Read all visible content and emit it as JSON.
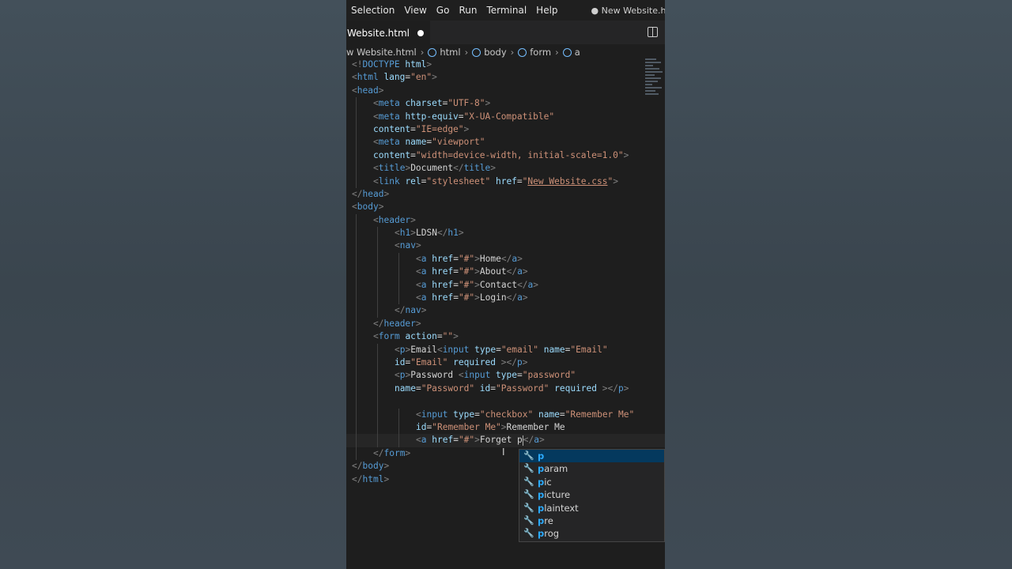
{
  "menu": [
    "Selection",
    "View",
    "Go",
    "Run",
    "Terminal",
    "Help"
  ],
  "window_title": "● New Website.html - Co",
  "tab": {
    "label": "Website.html"
  },
  "breadcrumb": [
    "w Website.html",
    "html",
    "body",
    "form",
    "a"
  ],
  "suggestions": [
    {
      "prefix": "p",
      "rest": ""
    },
    {
      "prefix": "p",
      "rest": "aram"
    },
    {
      "prefix": "p",
      "rest": "ic"
    },
    {
      "prefix": "p",
      "rest": "icture"
    },
    {
      "prefix": "p",
      "rest": "laintext"
    },
    {
      "prefix": "p",
      "rest": "re"
    },
    {
      "prefix": "p",
      "rest": "rog"
    }
  ],
  "colors": {
    "tag": "#569cd6",
    "attr": "#9cdcfe",
    "string": "#ce9178",
    "text": "#d4d4d4",
    "bracket": "#808080"
  },
  "code": [
    {
      "indent": 0,
      "tokens": [
        [
          "t",
          "<!"
        ],
        [
          "tn",
          "DOCTYPE"
        ],
        [
          "at",
          " html"
        ],
        [
          "t",
          ">"
        ]
      ]
    },
    {
      "indent": 0,
      "tokens": [
        [
          "t",
          "<"
        ],
        [
          "tn",
          "html"
        ],
        [
          "at",
          " lang"
        ],
        [
          "tx",
          "="
        ],
        [
          "st",
          "\"en\""
        ],
        [
          "t",
          ">"
        ]
      ]
    },
    {
      "indent": 0,
      "tokens": [
        [
          "t",
          "<"
        ],
        [
          "tn",
          "head"
        ],
        [
          "t",
          ">"
        ]
      ]
    },
    {
      "indent": 1,
      "tokens": [
        [
          "t",
          "<"
        ],
        [
          "tn",
          "meta"
        ],
        [
          "at",
          " charset"
        ],
        [
          "tx",
          "="
        ],
        [
          "st",
          "\"UTF-8\""
        ],
        [
          "t",
          ">"
        ]
      ]
    },
    {
      "indent": 1,
      "tokens": [
        [
          "t",
          "<"
        ],
        [
          "tn",
          "meta"
        ],
        [
          "at",
          " http-equiv"
        ],
        [
          "tx",
          "="
        ],
        [
          "st",
          "\"X-UA-Compatible\""
        ]
      ]
    },
    {
      "indent": 1,
      "tokens": [
        [
          "at",
          "content"
        ],
        [
          "tx",
          "="
        ],
        [
          "st",
          "\"IE=edge\""
        ],
        [
          "t",
          ">"
        ]
      ]
    },
    {
      "indent": 1,
      "tokens": [
        [
          "t",
          "<"
        ],
        [
          "tn",
          "meta"
        ],
        [
          "at",
          " name"
        ],
        [
          "tx",
          "="
        ],
        [
          "st",
          "\"viewport\""
        ]
      ]
    },
    {
      "indent": 1,
      "tokens": [
        [
          "at",
          "content"
        ],
        [
          "tx",
          "="
        ],
        [
          "st",
          "\"width=device-width, initial-scale=1.0\""
        ],
        [
          "t",
          ">"
        ]
      ]
    },
    {
      "indent": 1,
      "tokens": [
        [
          "t",
          "<"
        ],
        [
          "tn",
          "title"
        ],
        [
          "t",
          ">"
        ],
        [
          "tx",
          "Document"
        ],
        [
          "t",
          "</"
        ],
        [
          "tn",
          "title"
        ],
        [
          "t",
          ">"
        ]
      ]
    },
    {
      "indent": 1,
      "tokens": [
        [
          "t",
          "<"
        ],
        [
          "tn",
          "link"
        ],
        [
          "at",
          " rel"
        ],
        [
          "tx",
          "="
        ],
        [
          "st",
          "\"stylesheet\""
        ],
        [
          "at",
          " href"
        ],
        [
          "tx",
          "="
        ],
        [
          "st",
          "\""
        ],
        [
          "stu",
          "New Website.css"
        ],
        [
          "st",
          "\""
        ],
        [
          "t",
          ">"
        ]
      ]
    },
    {
      "indent": 0,
      "tokens": [
        [
          "t",
          "</"
        ],
        [
          "tn",
          "head"
        ],
        [
          "t",
          ">"
        ]
      ]
    },
    {
      "indent": 0,
      "tokens": [
        [
          "t",
          "<"
        ],
        [
          "tn",
          "body"
        ],
        [
          "t",
          ">"
        ]
      ]
    },
    {
      "indent": 1,
      "tokens": [
        [
          "t",
          "<"
        ],
        [
          "tn",
          "header"
        ],
        [
          "t",
          ">"
        ]
      ]
    },
    {
      "indent": 2,
      "tokens": [
        [
          "t",
          "<"
        ],
        [
          "tn",
          "h1"
        ],
        [
          "t",
          ">"
        ],
        [
          "tx",
          "LDSN"
        ],
        [
          "t",
          "</"
        ],
        [
          "tn",
          "h1"
        ],
        [
          "t",
          ">"
        ]
      ]
    },
    {
      "indent": 2,
      "tokens": [
        [
          "t",
          "<"
        ],
        [
          "tn",
          "nav"
        ],
        [
          "t",
          ">"
        ]
      ]
    },
    {
      "indent": 3,
      "tokens": [
        [
          "t",
          "<"
        ],
        [
          "tn",
          "a"
        ],
        [
          "at",
          " href"
        ],
        [
          "tx",
          "="
        ],
        [
          "st",
          "\"#\""
        ],
        [
          "t",
          ">"
        ],
        [
          "tx",
          "Home"
        ],
        [
          "t",
          "</"
        ],
        [
          "tn",
          "a"
        ],
        [
          "t",
          ">"
        ]
      ]
    },
    {
      "indent": 3,
      "tokens": [
        [
          "t",
          "<"
        ],
        [
          "tn",
          "a"
        ],
        [
          "at",
          " href"
        ],
        [
          "tx",
          "="
        ],
        [
          "st",
          "\"#\""
        ],
        [
          "t",
          ">"
        ],
        [
          "tx",
          "About"
        ],
        [
          "t",
          "</"
        ],
        [
          "tn",
          "a"
        ],
        [
          "t",
          ">"
        ]
      ]
    },
    {
      "indent": 3,
      "tokens": [
        [
          "t",
          "<"
        ],
        [
          "tn",
          "a"
        ],
        [
          "at",
          " href"
        ],
        [
          "tx",
          "="
        ],
        [
          "st",
          "\"#\""
        ],
        [
          "t",
          ">"
        ],
        [
          "tx",
          "Contact"
        ],
        [
          "t",
          "</"
        ],
        [
          "tn",
          "a"
        ],
        [
          "t",
          ">"
        ]
      ]
    },
    {
      "indent": 3,
      "tokens": [
        [
          "t",
          "<"
        ],
        [
          "tn",
          "a"
        ],
        [
          "at",
          " href"
        ],
        [
          "tx",
          "="
        ],
        [
          "st",
          "\"#\""
        ],
        [
          "t",
          ">"
        ],
        [
          "tx",
          "Login"
        ],
        [
          "t",
          "</"
        ],
        [
          "tn",
          "a"
        ],
        [
          "t",
          ">"
        ]
      ]
    },
    {
      "indent": 2,
      "tokens": [
        [
          "t",
          "</"
        ],
        [
          "tn",
          "nav"
        ],
        [
          "t",
          ">"
        ]
      ]
    },
    {
      "indent": 1,
      "tokens": [
        [
          "t",
          "</"
        ],
        [
          "tn",
          "header"
        ],
        [
          "t",
          ">"
        ]
      ]
    },
    {
      "indent": 1,
      "tokens": [
        [
          "t",
          "<"
        ],
        [
          "tn",
          "form"
        ],
        [
          "at",
          " action"
        ],
        [
          "tx",
          "="
        ],
        [
          "st",
          "\"\""
        ],
        [
          "t",
          ">"
        ]
      ]
    },
    {
      "indent": 2,
      "tokens": [
        [
          "t",
          "<"
        ],
        [
          "tn",
          "p"
        ],
        [
          "t",
          ">"
        ],
        [
          "tx",
          "Email"
        ],
        [
          "t",
          "<"
        ],
        [
          "tn",
          "input"
        ],
        [
          "at",
          " type"
        ],
        [
          "tx",
          "="
        ],
        [
          "st",
          "\"email\""
        ],
        [
          "at",
          " name"
        ],
        [
          "tx",
          "="
        ],
        [
          "st",
          "\"Email\""
        ]
      ]
    },
    {
      "indent": 2,
      "tokens": [
        [
          "at",
          "id"
        ],
        [
          "tx",
          "="
        ],
        [
          "st",
          "\"Email\""
        ],
        [
          "at",
          " required"
        ],
        [
          "t",
          " ></"
        ],
        [
          "tn",
          "p"
        ],
        [
          "t",
          ">"
        ]
      ]
    },
    {
      "indent": 2,
      "tokens": [
        [
          "t",
          "<"
        ],
        [
          "tn",
          "p"
        ],
        [
          "t",
          ">"
        ],
        [
          "tx",
          "Password "
        ],
        [
          "t",
          "<"
        ],
        [
          "tn",
          "input"
        ],
        [
          "at",
          " type"
        ],
        [
          "tx",
          "="
        ],
        [
          "st",
          "\"password\""
        ]
      ]
    },
    {
      "indent": 2,
      "tokens": [
        [
          "at",
          "name"
        ],
        [
          "tx",
          "="
        ],
        [
          "st",
          "\"Password\""
        ],
        [
          "at",
          " id"
        ],
        [
          "tx",
          "="
        ],
        [
          "st",
          "\"Password\""
        ],
        [
          "at",
          " required"
        ],
        [
          "t",
          " ></"
        ],
        [
          "tn",
          "p"
        ],
        [
          "t",
          ">"
        ]
      ]
    },
    {
      "indent": 2,
      "tokens": []
    },
    {
      "indent": 3,
      "tokens": [
        [
          "t",
          "<"
        ],
        [
          "tn",
          "input"
        ],
        [
          "at",
          " type"
        ],
        [
          "tx",
          "="
        ],
        [
          "st",
          "\"checkbox\""
        ],
        [
          "at",
          " name"
        ],
        [
          "tx",
          "="
        ],
        [
          "st",
          "\"Remember Me\""
        ]
      ]
    },
    {
      "indent": 3,
      "tokens": [
        [
          "at",
          "id"
        ],
        [
          "tx",
          "="
        ],
        [
          "st",
          "\"Remember Me\""
        ],
        [
          "t",
          ">"
        ],
        [
          "tx",
          "Remember Me"
        ]
      ]
    },
    {
      "indent": 3,
      "cur": true,
      "tokens": [
        [
          "t",
          "<"
        ],
        [
          "tn",
          "a"
        ],
        [
          "at",
          " href"
        ],
        [
          "tx",
          "="
        ],
        [
          "st",
          "\"#\""
        ],
        [
          "t",
          ">"
        ],
        [
          "tx",
          "Forget p"
        ],
        [
          "caret",
          ""
        ],
        [
          "t",
          "</"
        ],
        [
          "tn",
          "a"
        ],
        [
          "t",
          ">"
        ]
      ]
    },
    {
      "indent": 1,
      "tokens": [
        [
          "t",
          "</"
        ],
        [
          "tn",
          "form"
        ],
        [
          "t",
          ">"
        ]
      ]
    },
    {
      "indent": 0,
      "tokens": [
        [
          "t",
          "</"
        ],
        [
          "tn",
          "body"
        ],
        [
          "t",
          ">"
        ]
      ]
    },
    {
      "indent": 0,
      "tokens": [
        [
          "t",
          "</"
        ],
        [
          "tn",
          "html"
        ],
        [
          "t",
          ">"
        ]
      ]
    }
  ]
}
